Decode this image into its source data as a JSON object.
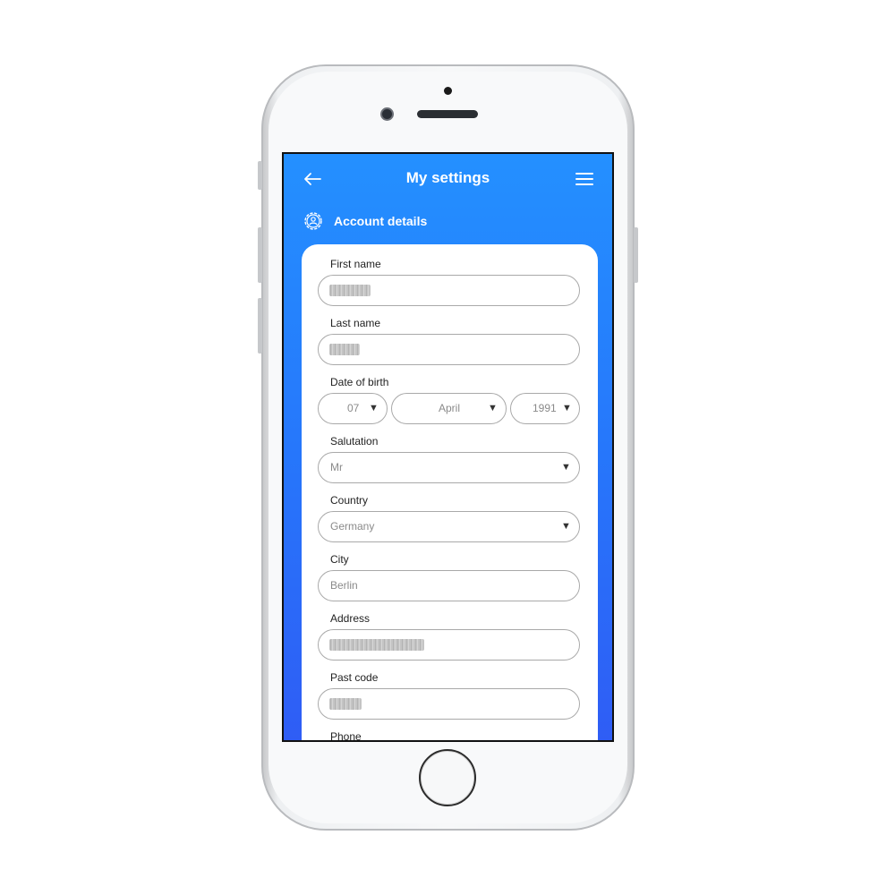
{
  "header": {
    "title": "My settings",
    "back_icon": "arrow-left-icon",
    "menu_icon": "hamburger-menu-icon"
  },
  "section": {
    "label": "Account details",
    "icon": "user-gear-icon"
  },
  "colors": {
    "screen_top": "#2490ff",
    "screen_bottom": "#2f5df5",
    "card": "#ffffff",
    "field_border": "#a9a9a9"
  },
  "form": {
    "first_name": {
      "label": "First name",
      "value_obscured": true
    },
    "last_name": {
      "label": "Last name",
      "value_obscured": true
    },
    "date_of_birth": {
      "label": "Date of birth",
      "day": "07",
      "month": "April",
      "year": "1991"
    },
    "salutation": {
      "label": "Salutation",
      "value": "Mr"
    },
    "country": {
      "label": "Country",
      "value": "Germany"
    },
    "city": {
      "label": "City",
      "value": "Berlin"
    },
    "address": {
      "label": "Address",
      "value_obscured": true
    },
    "post_code": {
      "label": "Past code",
      "value_obscured": true
    },
    "phone": {
      "label": "Phone"
    }
  },
  "caret": "▼"
}
